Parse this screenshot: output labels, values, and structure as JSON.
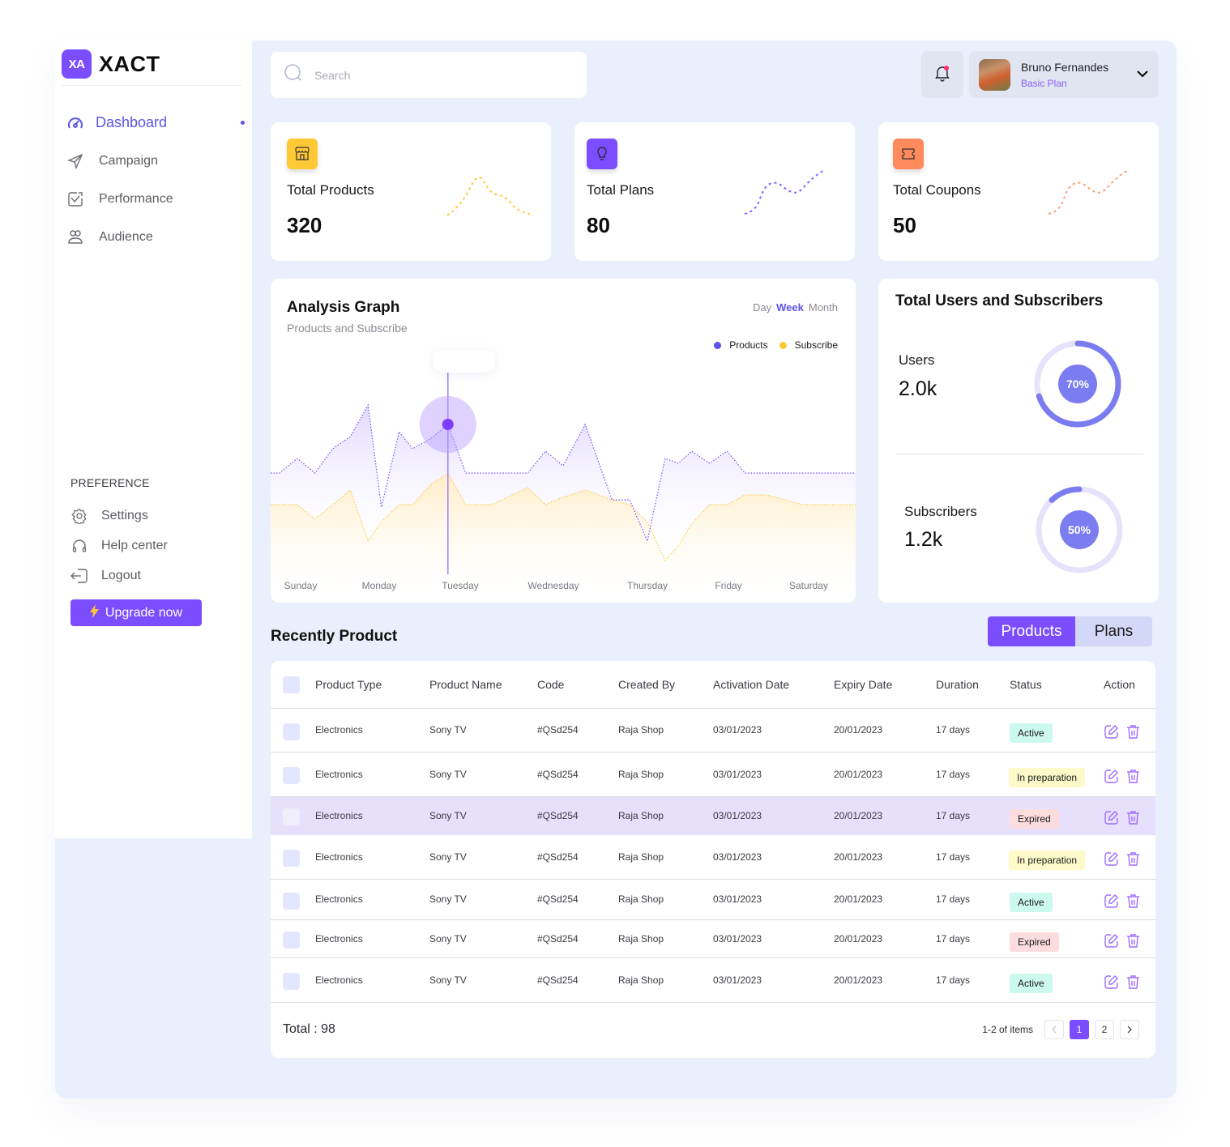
{
  "brand": {
    "badge": "XA",
    "name": "XACT"
  },
  "sidebar": {
    "items": [
      {
        "label": "Dashboard",
        "icon": "dashboard-gauge-icon",
        "active": true
      },
      {
        "label": "Campaign",
        "icon": "send-icon",
        "active": false
      },
      {
        "label": "Performance",
        "icon": "performance-chart-icon",
        "active": false
      },
      {
        "label": "Audience",
        "icon": "audience-icon",
        "active": false
      }
    ],
    "preference_title": "PREFERENCE",
    "preference_items": [
      {
        "label": "Settings",
        "icon": "gear-icon"
      },
      {
        "label": "Help center",
        "icon": "headphones-icon"
      },
      {
        "label": "Logout",
        "icon": "logout-icon"
      }
    ],
    "upgrade_label": "Upgrade now"
  },
  "header": {
    "search_placeholder": "Search",
    "notification_unread": true,
    "user": {
      "name": "Bruno Fernandes",
      "plan": "Basic Plan"
    }
  },
  "stats": [
    {
      "label": "Total Products",
      "value": "320",
      "icon": "store-icon",
      "color": "#ffc935"
    },
    {
      "label": "Total Plans",
      "value": "80",
      "icon": "lightbulb-icon",
      "color": "#7b4dff"
    },
    {
      "label": "Total Coupons",
      "value": "50",
      "icon": "ticket-icon",
      "color": "#ff8a5c"
    }
  ],
  "analysis": {
    "title": "Analysis Graph",
    "subtitle": "Products and Subscribe",
    "ranges": [
      "Day",
      "Week",
      "Month"
    ],
    "active_range": "Week",
    "legend": [
      {
        "label": "Products",
        "color": "#5b54e8"
      },
      {
        "label": "Subscribe",
        "color": "#ffc935"
      }
    ]
  },
  "chart_data": {
    "type": "area",
    "title": "Analysis Graph",
    "subtitle": "Products and Subscribe",
    "categories": [
      "Sunday",
      "Monday",
      "Tuesday",
      "Wednesday",
      "Thursday",
      "Friday",
      "Saturday"
    ],
    "x": [
      0,
      0.1,
      0.3,
      0.5,
      0.7,
      0.9,
      1.1,
      1.25,
      1.45,
      1.6,
      1.8,
      2.0,
      2.2,
      2.5,
      2.9,
      3.1,
      3.3,
      3.55,
      3.85,
      4.05,
      4.25,
      4.45,
      4.6,
      4.75,
      4.95,
      5.15,
      5.35,
      5.6,
      6.0,
      6.6
    ],
    "series": [
      {
        "name": "Products",
        "color": "#7b4dff",
        "values": [
          50,
          50,
          56,
          50,
          60,
          65,
          78,
          36,
          67,
          60,
          64,
          70,
          50,
          50,
          50,
          59,
          53,
          70,
          39,
          39,
          22,
          56,
          54,
          59,
          54,
          59,
          50,
          50,
          50,
          50
        ]
      },
      {
        "name": "Subscribe",
        "color": "#ffc935",
        "values": [
          37,
          37,
          37,
          31,
          37,
          43,
          22,
          30,
          37,
          37,
          45,
          50,
          37,
          37,
          44,
          37,
          40,
          43,
          39,
          37,
          30,
          14,
          20,
          29,
          37,
          37,
          41,
          41,
          37,
          37
        ]
      }
    ],
    "highlight": {
      "series": "Products",
      "category": "Tuesday"
    },
    "xlabel": "",
    "ylabel": "",
    "ylim": [
      0,
      100
    ],
    "grid": false,
    "legend_position": "top-right"
  },
  "users_card": {
    "title": "Total Users and Subscribers",
    "metrics": [
      {
        "label": "Users",
        "value": "2.0k",
        "percent": 70,
        "percent_label": "70%"
      },
      {
        "label": "Subscribers",
        "value": "1.2k",
        "percent": 50,
        "percent_label": "50%"
      }
    ]
  },
  "recent": {
    "title": "Recently  Product",
    "tabs": [
      "Products",
      "Plans"
    ],
    "active_tab": "Products",
    "columns": [
      "Product Type",
      "Product Name",
      "Code",
      "Created By",
      "Activation Date",
      "Expiry Date",
      "Duration",
      "Status",
      "Action"
    ],
    "rows": [
      {
        "type": "Electronics",
        "name": "Sony TV",
        "code": "#QSd254",
        "created_by": "Raja Shop",
        "activation": "03/01/2023",
        "expiry": "20/01/2023",
        "duration": "17 days",
        "status": "Active",
        "selected": false
      },
      {
        "type": "Electronics",
        "name": "Sony TV",
        "code": "#QSd254",
        "created_by": "Raja Shop",
        "activation": "03/01/2023",
        "expiry": "20/01/2023",
        "duration": "17 days",
        "status": "In preparation",
        "selected": false
      },
      {
        "type": "Electronics",
        "name": "Sony TV",
        "code": "#QSd254",
        "created_by": "Raja Shop",
        "activation": "03/01/2023",
        "expiry": "20/01/2023",
        "duration": "17 days",
        "status": "Expired",
        "selected": true
      },
      {
        "type": "Electronics",
        "name": "Sony TV",
        "code": "#QSd254",
        "created_by": "Raja Shop",
        "activation": "03/01/2023",
        "expiry": "20/01/2023",
        "duration": "17 days",
        "status": "In preparation",
        "selected": false
      },
      {
        "type": "Electronics",
        "name": "Sony TV",
        "code": "#QSd254",
        "created_by": "Raja Shop",
        "activation": "03/01/2023",
        "expiry": "20/01/2023",
        "duration": "17 days",
        "status": "Active",
        "selected": false
      },
      {
        "type": "Electronics",
        "name": "Sony TV",
        "code": "#QSd254",
        "created_by": "Raja Shop",
        "activation": "03/01/2023",
        "expiry": "20/01/2023",
        "duration": "17 days",
        "status": "Expired",
        "selected": false
      },
      {
        "type": "Electronics",
        "name": "Sony TV",
        "code": "#QSd254",
        "created_by": "Raja Shop",
        "activation": "03/01/2023",
        "expiry": "20/01/2023",
        "duration": "17 days",
        "status": "Active",
        "selected": false
      }
    ],
    "total_label": "Total : 98",
    "pagination": {
      "info": "1-2 of items",
      "pages": [
        "1",
        "2"
      ],
      "current": "1"
    }
  }
}
